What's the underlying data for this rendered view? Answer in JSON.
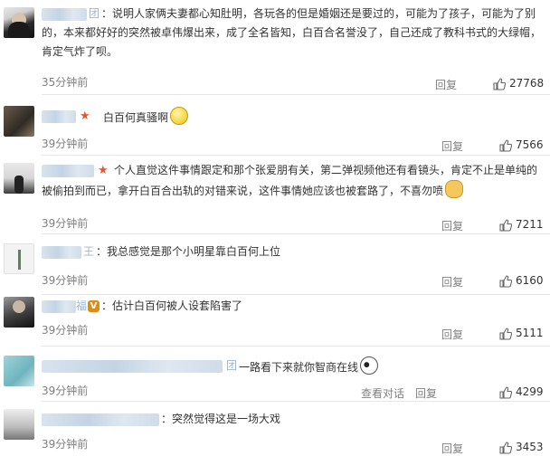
{
  "comments": [
    {
      "name_tail": "团",
      "text_pre": "：说明人家俩夫妻都心知肚明，各玩各的但是婚姻还是要过的，可能为了孩子，可能为了别的，本来都好好的突然被卓伟爆出来，成了全名皆知，白百合名誉没了，自己还成了教科书式的大绿帽，肯定气炸了呗。",
      "time": "35分钟前",
      "reply": "回复",
      "likes": "27768"
    },
    {
      "name_tail": "",
      "text_pre": "白百何真骚啊",
      "time": "39分钟前",
      "reply": "回复",
      "likes": "7566"
    },
    {
      "name_tail": "",
      "text_pre": "个人直觉这件事情跟定和那个张爱朋有关，第二弹视频他还有看镜头，肯定不止是单纯的被偷拍到而已，拿开白百合出轨的对错来说，这件事情她应该也被套路了，不喜勿喷",
      "time": "39分钟前",
      "reply": "回复",
      "likes": "7211"
    },
    {
      "name_tail": "王",
      "text_pre": "：我总感觉是那个小明星靠白百何上位",
      "time": "39分钟前",
      "reply": "回复",
      "likes": "6160"
    },
    {
      "name_tail": "福",
      "text_pre": "：估计白百何被人设套陷害了",
      "time": "39分钟前",
      "reply": "回复",
      "likes": "5111"
    },
    {
      "name_tail": "团",
      "text_pre": "一路看下来就你智商在线",
      "time": "39分钟前",
      "reply": "查看对话　回复",
      "likes": "4299"
    },
    {
      "name_tail": "",
      "text_pre": "：突然觉得这是一场大戏",
      "time": "39分钟前",
      "reply": "回复",
      "likes": "3453"
    }
  ]
}
